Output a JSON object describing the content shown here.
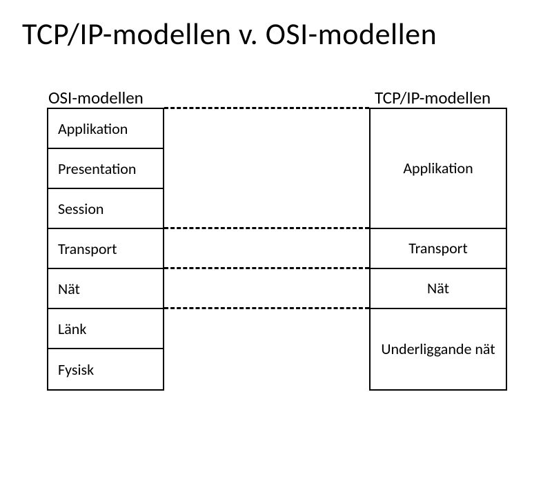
{
  "title": "TCP/IP-modellen v. OSI-modellen",
  "osi": {
    "header": "OSI-modellen",
    "layers": [
      "Applikation",
      "Presentation",
      "Session",
      "Transport",
      "Nät",
      "Länk",
      "Fysisk"
    ]
  },
  "tcpip": {
    "header": "TCP/IP-modellen",
    "layers": [
      "Applikation",
      "Transport",
      "Nät",
      "Underliggande nät"
    ]
  }
}
